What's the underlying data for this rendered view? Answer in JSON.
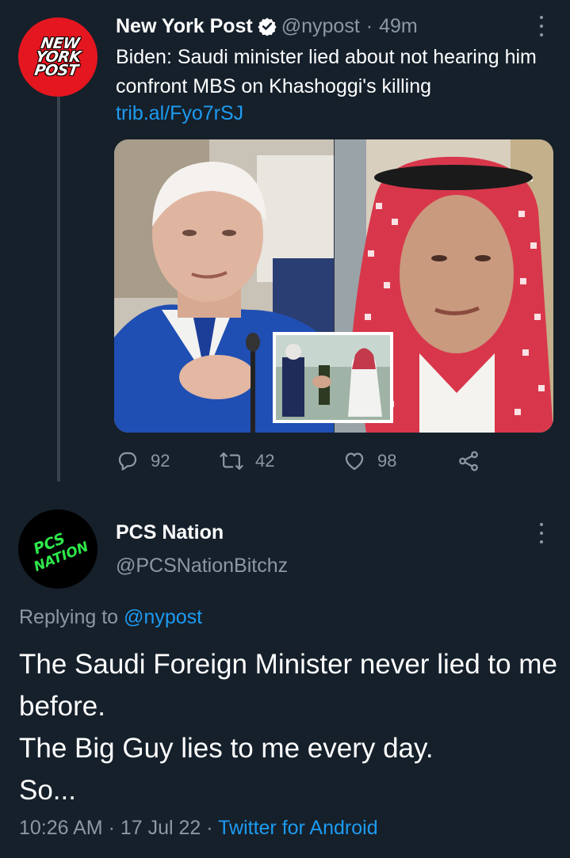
{
  "tweet1": {
    "avatar_logo_lines": [
      "NEW",
      "YORK",
      "POST"
    ],
    "display_name": "New York Post",
    "handle": "@nypost",
    "separator": "·",
    "time": "49m",
    "text": "Biden: Saudi minister lied about not hearing him confront MBS on Khashoggi's killing",
    "link": "trib.al/Fyo7rSJ",
    "stats": {
      "replies": "92",
      "retweets": "42",
      "likes": "98"
    },
    "icons": [
      "verified-badge-icon",
      "more-options-icon",
      "reply-icon",
      "retweet-icon",
      "like-icon",
      "share-icon"
    ]
  },
  "tweet2": {
    "avatar_logo_lines": [
      "PCS",
      "NATION"
    ],
    "display_name": "PCS Nation",
    "handle": "@PCSNationBitchz",
    "replying_prefix": "Replying to",
    "replying_handle": "@nypost",
    "text_lines": [
      "The Saudi Foreign Minister never lied to me before.",
      "The Big Guy lies to me every day.",
      "So..."
    ],
    "time": "10:26 AM",
    "date": "17 Jul 22",
    "app": "Twitter for Android"
  },
  "colors": {
    "background": "#15202b",
    "primary_text": "#ffffff",
    "secondary_text": "#8b98a5",
    "accent": "#1d9bf0",
    "nypost_red": "#e4161f",
    "pcs_green": "#2ee84a"
  }
}
